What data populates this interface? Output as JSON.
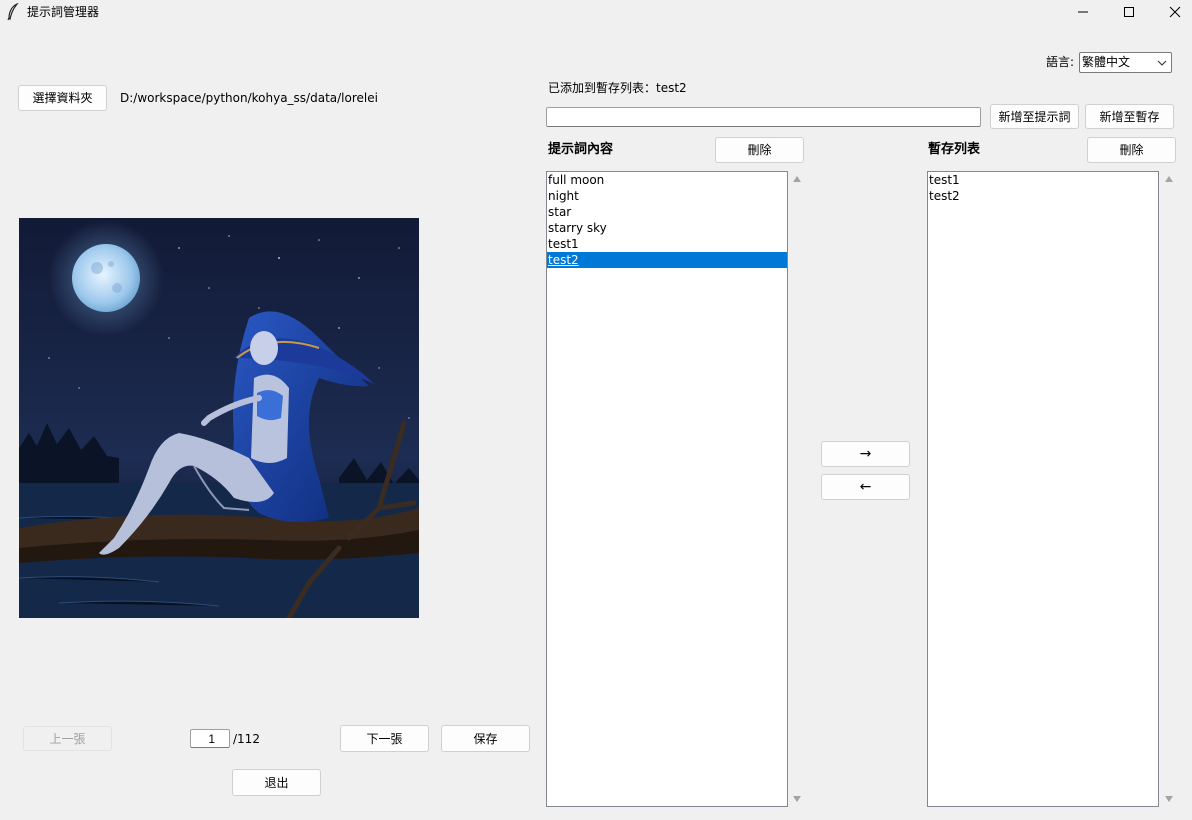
{
  "window": {
    "title": "提示詞管理器",
    "icon": "feather-icon",
    "controls": [
      "minimize-icon",
      "maximize-icon",
      "close-icon"
    ]
  },
  "language": {
    "label": "語言:",
    "selected": "繁體中文"
  },
  "folder": {
    "select_button": "選擇資料夾",
    "path": "D:/workspace/python/kohya_ss/data/lorelei"
  },
  "status_message": "已添加到暫存列表：test2",
  "input": {
    "value": "",
    "add_to_prompts_button": "新增至提示詞",
    "add_to_temp_button": "新增至暫存"
  },
  "prompts": {
    "heading": "提示詞內容",
    "delete_button": "刪除",
    "items": [
      "full moon",
      "night",
      "star",
      "starry sky",
      "test1",
      "test2"
    ],
    "selected_index": 5
  },
  "temp_list": {
    "heading": "暫存列表",
    "delete_button": "刪除",
    "items": [
      "test1",
      "test2"
    ]
  },
  "transfer": {
    "right_button": "→",
    "left_button": "←"
  },
  "navigation": {
    "prev_button": "上一張",
    "page_value": "1",
    "page_total": "/112",
    "next_button": "下一張",
    "save_button": "保存",
    "exit_button": "退出"
  },
  "colors": {
    "background": "#f0f0f0",
    "selection": "#0078d7",
    "button_face": "#fdfdfd"
  }
}
